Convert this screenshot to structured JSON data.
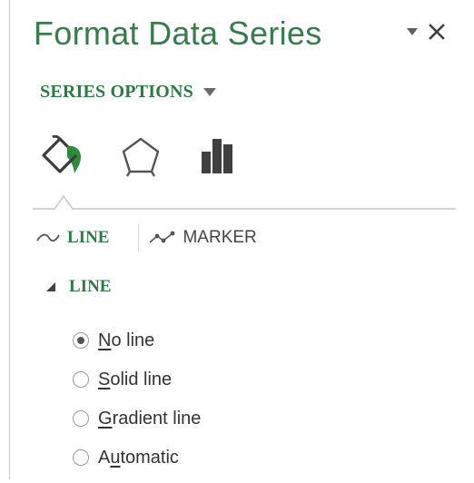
{
  "pane": {
    "title": "Format Data Series"
  },
  "series_options": {
    "label": "SERIES OPTIONS"
  },
  "icon_tabs": [
    {
      "name": "fill-line",
      "icon": "paint-bucket-icon"
    },
    {
      "name": "effects",
      "icon": "pentagon-icon"
    },
    {
      "name": "series-options",
      "icon": "bar-chart-icon"
    }
  ],
  "sub_tabs": {
    "line": "LINE",
    "marker": "MARKER"
  },
  "section": {
    "title": "LINE"
  },
  "line_options": [
    {
      "key": "N",
      "rest": "o line",
      "prefix": "",
      "checked": true
    },
    {
      "key": "S",
      "rest": "olid line",
      "prefix": "",
      "checked": false
    },
    {
      "key": "G",
      "rest": "radient line",
      "prefix": "",
      "checked": false
    },
    {
      "key": "u",
      "rest": "tomatic",
      "prefix": "A",
      "checked": false
    }
  ],
  "colors": {
    "accent": "#2e7a46",
    "title": "#3a7a4f",
    "icon_dark": "#404040",
    "icon_green": "#2e8b3e"
  }
}
